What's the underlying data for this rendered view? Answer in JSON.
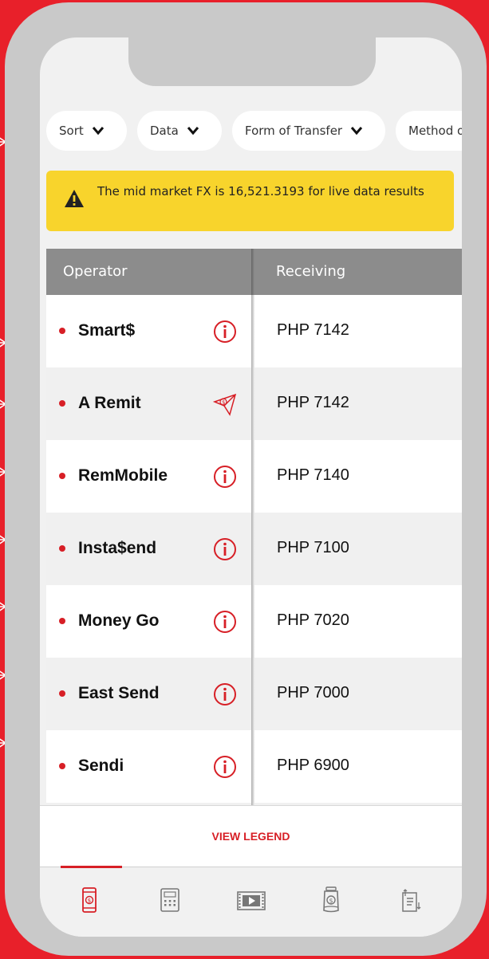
{
  "filters": [
    {
      "label": "Sort"
    },
    {
      "label": "Data"
    },
    {
      "label": "Form of Transfer"
    },
    {
      "label": "Method o"
    }
  ],
  "banner": {
    "message": "The mid market FX is 16,521.3193 for live data results",
    "icon": "warning-icon"
  },
  "table": {
    "headers": {
      "operator": "Operator",
      "receiving": "Receiving"
    },
    "rows": [
      {
        "operator": "Smart$",
        "receiving": "PHP 7142",
        "icon": "info-icon"
      },
      {
        "operator": "A Remit",
        "receiving": "PHP 7142",
        "icon": "send-money-icon"
      },
      {
        "operator": "RemMobile",
        "receiving": "PHP 7140",
        "icon": "info-icon"
      },
      {
        "operator": "Insta$end",
        "receiving": "PHP 7100",
        "icon": "info-icon"
      },
      {
        "operator": "Money Go",
        "receiving": "PHP 7020",
        "icon": "info-icon"
      },
      {
        "operator": "East Send",
        "receiving": "PHP 7000",
        "icon": "info-icon"
      },
      {
        "operator": "Sendi",
        "receiving": "PHP 6900",
        "icon": "info-icon"
      }
    ]
  },
  "legend": {
    "label": "VIEW LEGEND"
  },
  "tabs": [
    {
      "icon": "phone-money-icon",
      "active": true
    },
    {
      "icon": "calculator-icon",
      "active": false
    },
    {
      "icon": "video-icon",
      "active": false
    },
    {
      "icon": "money-jar-icon",
      "active": false
    },
    {
      "icon": "sort-list-icon",
      "active": false
    }
  ],
  "colors": {
    "accent": "#d71f26",
    "banner": "#f8d42c",
    "header": "#8c8c8c",
    "frame": "#e8202a"
  }
}
